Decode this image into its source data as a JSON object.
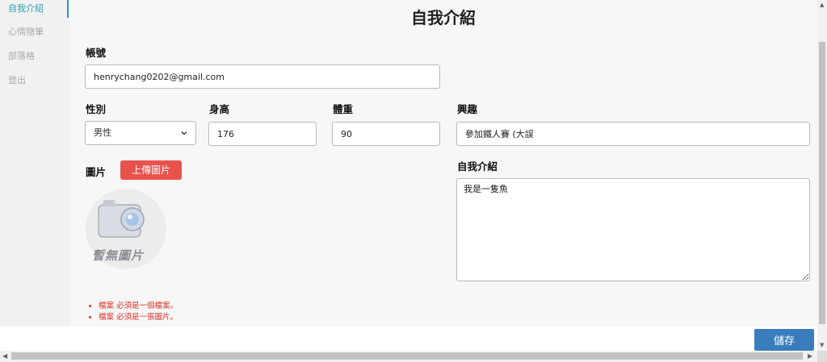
{
  "sidebar": {
    "items": [
      {
        "label": "自我介紹",
        "active": true
      },
      {
        "label": "心情隨筆",
        "active": false
      },
      {
        "label": "部落格",
        "active": false
      },
      {
        "label": "登出",
        "active": false
      }
    ]
  },
  "page": {
    "title": "自我介紹"
  },
  "form": {
    "account_label": "帳號",
    "account_value": "henrychang0202@gmail.com",
    "gender_label": "性別",
    "gender_value": "男性",
    "height_label": "身高",
    "height_value": "176",
    "weight_label": "體重",
    "weight_value": "90",
    "hobby_label": "興趣",
    "hobby_value": "參加鐵人賽 (大誤",
    "intro_label": "自我介紹",
    "intro_value": "我是一隻魚",
    "picture_label": "圖片",
    "upload_label": "上傳圖片",
    "no_image_text": "暫無圖片"
  },
  "errors": [
    "檔案 必須是一個檔案。",
    "檔案 必須是一張圖片。"
  ],
  "actions": {
    "save_label": "儲存"
  },
  "colors": {
    "accent": "#2a9fb0",
    "upload": "#e8524d",
    "save": "#3a7dbd",
    "error": "#d93025"
  }
}
